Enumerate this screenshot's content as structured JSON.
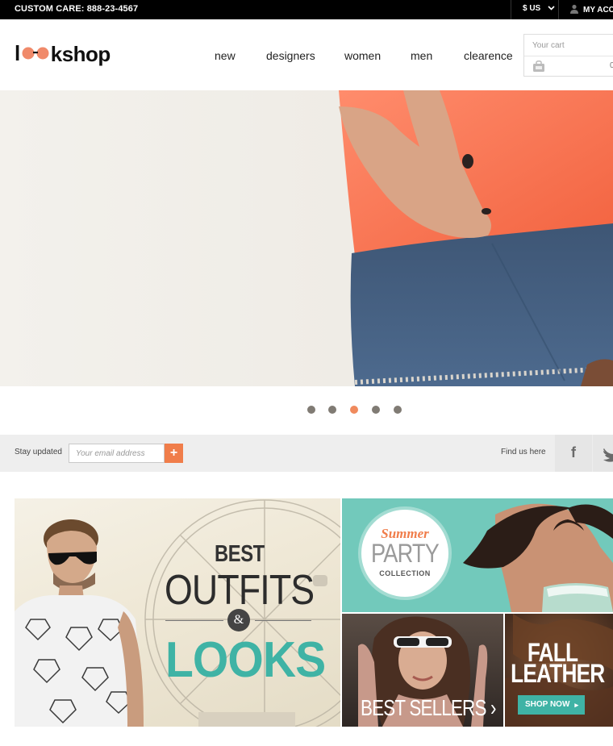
{
  "topbar": {
    "care": "CUSTOM CARE: 888-23-4567",
    "currency": "$ US",
    "account": "MY ACC"
  },
  "logo": {
    "text_left": "l",
    "text_right": "kshop"
  },
  "nav": {
    "items": [
      "new",
      "designers",
      "women",
      "men",
      "clearence"
    ]
  },
  "cart": {
    "label": "Your cart",
    "count": "0"
  },
  "slider": {
    "dots": 5,
    "active_index": 2
  },
  "newsletter": {
    "label": "Stay updated",
    "placeholder": "Your email address",
    "submit": "+",
    "find_us": "Find us here",
    "facebook": "f"
  },
  "promos": {
    "outfits": {
      "line1": "BEST",
      "line2": "OUTFITS",
      "amp": "&",
      "line3": "LOOKS"
    },
    "summer": {
      "line1": "Summer",
      "line2": "PARTY",
      "line3": "COLLECTION"
    },
    "best_sellers": {
      "label": "BEST SELLERS",
      "arrow": "›"
    },
    "fall": {
      "line1": "FALL",
      "line2": "LEATHER",
      "button": "SHOP NOW",
      "arrow": "▸"
    }
  },
  "colors": {
    "accent": "#f07d4a",
    "teal": "#3fb3a5",
    "dot": "#807b74"
  },
  "icons": [
    "user-icon",
    "chevron-down-icon",
    "cart-bag-icon",
    "facebook-icon",
    "twitter-icon",
    "glasses-logo-icon"
  ]
}
